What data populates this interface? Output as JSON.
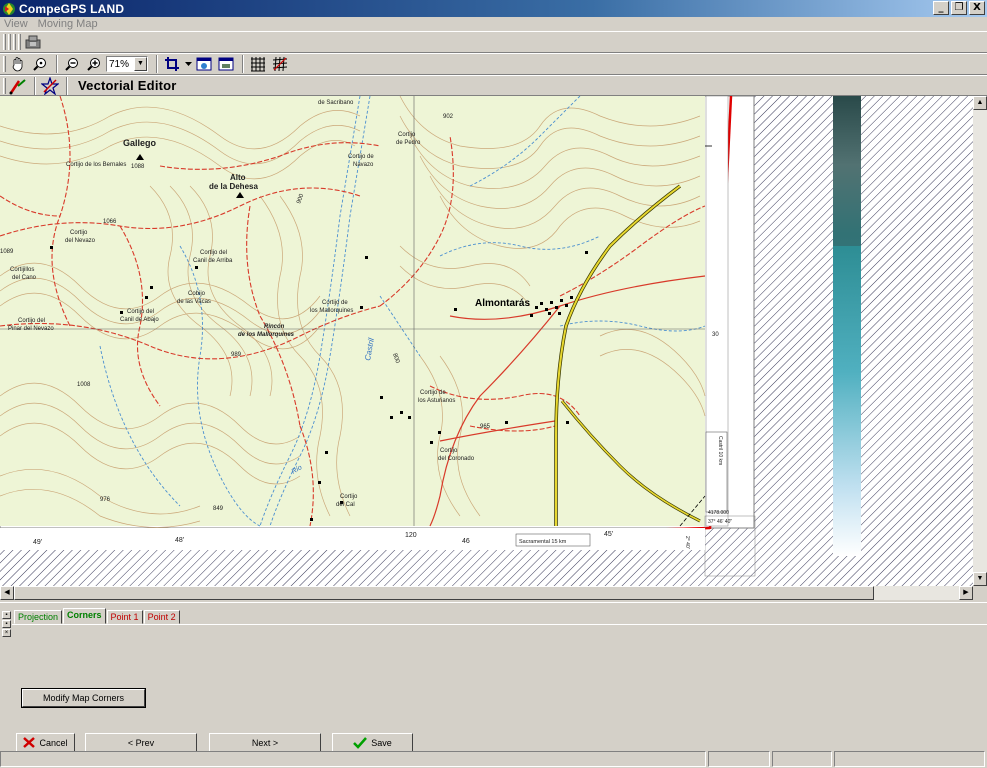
{
  "window": {
    "title": "CompeGPS LAND",
    "minimize": "_",
    "restore": "❐",
    "close": "X"
  },
  "menu": {
    "items": [
      "View",
      "Moving Map"
    ]
  },
  "toolbar2": {
    "zoom_value": "71%",
    "zoom_arrow": "▼"
  },
  "toolbar3": {
    "title": "Vectorial Editor"
  },
  "map": {
    "labels": {
      "gallego": "Gallego",
      "h1088": "1088",
      "cortijo_bernales": "Cortijo de los Bernales",
      "alto_dehesa_1": "Alto",
      "alto_dehesa_2": "de la Dehesa",
      "cortijo_navazo_top1": "Cortijo de",
      "cortijo_navazo_top2": "Navazo",
      "cortijo_pedro1": "Cortijo",
      "cortijo_pedro2": "de Pedro",
      "h902": "902",
      "de_sacribano": "de Sacribano",
      "h1066": "1066",
      "cortijo_nevazo1": "Cortijo",
      "cortijo_nevazo2": "del Nevazo",
      "h1089": "1089",
      "cortijillos1": "Cortijillos",
      "cortijillos2": "del Cano",
      "cortijo_canil_arriba1": "Cortijo del",
      "cortijo_canil_arriba2": "Canil de Arriba",
      "cobijo1": "Cobijo",
      "cobijo2": "de las Vacas",
      "cortijo_canil_abajo1": "Cortijo del",
      "cortijo_canil_abajo2": "Canil de Abajo",
      "cortijo_pinar1": "Cortijo del",
      "cortijo_pinar2": "Pinar del Nevazo",
      "rincon1": "Rincón",
      "rincon2": "de los Mallorquines",
      "cortijo_mallorquines1": "Cortijo de",
      "cortijo_mallorquines2": "los Mallorquines",
      "almontaras": "Almontarás",
      "h989": "989",
      "h1008": "1008",
      "castril": "Castril",
      "cortijo_asturianos1": "Cortijo de",
      "cortijo_asturianos2": "los Asturianos",
      "h965": "965",
      "cortijo_coronado1": "Cortijo",
      "cortijo_coronado2": "del Coronado",
      "rio": "Río",
      "h976": "976",
      "h849": "849",
      "cortijo_cal1": "Cortijo",
      "cortijo_cal2": "del Cal",
      "h800": "800",
      "h800b": "800",
      "h900": "900",
      "tick_40": "40",
      "tick_120": "120",
      "tick_49": "49'",
      "tick_48": "48'",
      "tick_45": "45'",
      "tick_46": "46",
      "tick_30": "30",
      "edge_sacramental": "Sacramental 15 km",
      "edge_castril": "Castril 10 km",
      "edge_coord1": "4178.000",
      "edge_coord2": "37° 46' 40\"",
      "edge_coord3": "2° 40'"
    }
  },
  "panel": {
    "tabs": [
      {
        "label": "Projection",
        "color": "#008000",
        "active": false
      },
      {
        "label": "Corners",
        "color": "#008000",
        "active": true
      },
      {
        "label": "Point 1",
        "color": "#c00000",
        "active": false
      },
      {
        "label": "Point 2",
        "color": "#c00000",
        "active": false
      }
    ],
    "modify_corners_label": "Modify Map Corners",
    "cancel_label": "Cancel",
    "prev_label": "< Prev",
    "next_label": "Next >",
    "save_label": "Save"
  },
  "colors": {
    "map_bg": "#eef5d6",
    "contour": "#c8a070",
    "road_red": "#d83a2a",
    "river": "#4a8fd0",
    "corner_line": "#e00000",
    "highway": "#c8b820"
  }
}
